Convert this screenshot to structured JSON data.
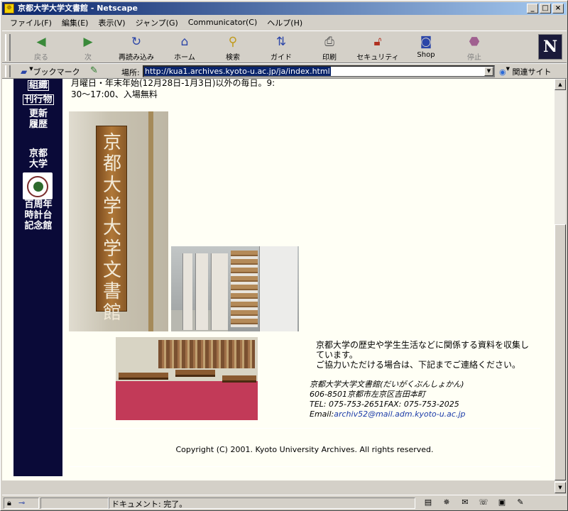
{
  "window": {
    "title": "京都大学大学文書館 - Netscape",
    "controls": [
      "_",
      "□",
      "×"
    ]
  },
  "menubar": {
    "items": [
      "ファイル(F)",
      "編集(E)",
      "表示(V)",
      "ジャンプ(G)",
      "Communicator(C)",
      "ヘルプ(H)"
    ]
  },
  "toolbar": {
    "back": "戻る",
    "forward": "次",
    "reload": "再読み込み",
    "home": "ホーム",
    "search": "検索",
    "guide": "ガイド",
    "print": "印刷",
    "security": "セキュリティ",
    "shop": "Shop",
    "stop": "停止",
    "logo": "N"
  },
  "location": {
    "bookmarks": "ブックマーク",
    "label": "場所:",
    "url": "http://kua1.archives.kyoto-u.ac.jp/ja/index.html",
    "related": "関連サイト"
  },
  "sidebar": {
    "items": [
      "組織",
      "刊行物",
      "更新",
      "履歴",
      "京都",
      "大学",
      "百周年",
      "時計台",
      "記念館"
    ]
  },
  "content": {
    "hours_line1": "月曜日・年末年始(12月28日-1月3日)以外の毎日。9:",
    "hours_line2": "30〜17:00、入場無料",
    "sign_text": "京都大学大学文書館",
    "description_line1": "京都大学の歴史や学生生活などに関係する資料を収集し",
    "description_line2": "ています。",
    "description_line3": "ご協力いただける場合は、下記までご連絡ください。",
    "contact": {
      "name": "京都大学大学文書館(だいがくぶんしょかん)",
      "address": "606-8501京都市左京区吉田本町",
      "tel_fax": "TEL: 075-753-2651FAX: 075-753-2025",
      "email_label": "Email:",
      "email": "archiv52@mail.adm.kyoto-u.ac.jp"
    },
    "copyright": "Copyright (C) 2001. Kyoto University Archives. All rights reserved."
  },
  "status": {
    "text": "ドキュメント: 完了。"
  },
  "colors": {
    "sidebar_bg": "#0a0a38",
    "page_bg": "#fffff5",
    "link": "#1a3aa8"
  }
}
